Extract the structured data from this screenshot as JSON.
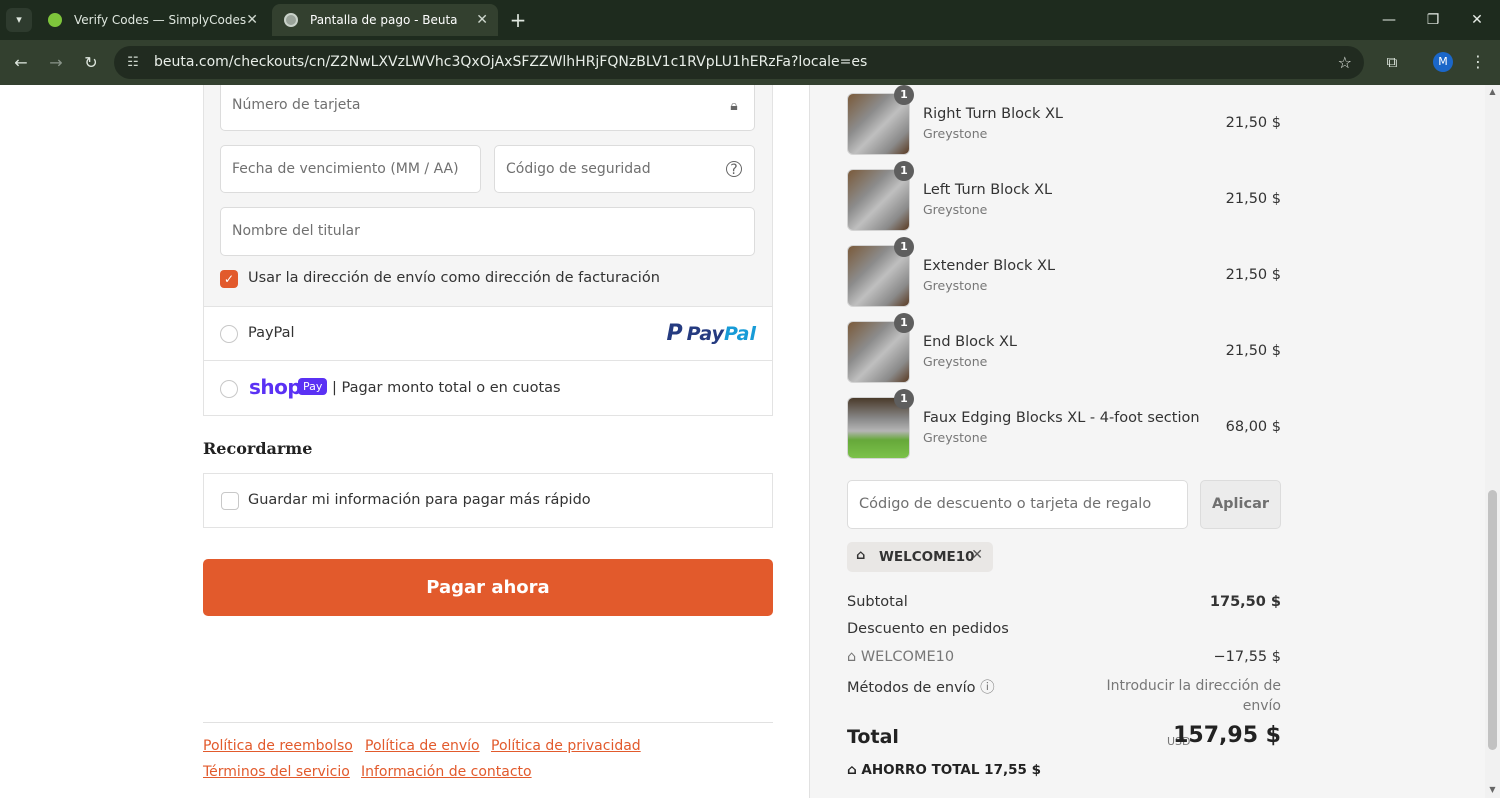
{
  "browser": {
    "tabs": [
      {
        "title": "Verify Codes — SimplyCodes",
        "active": false
      },
      {
        "title": "Pantalla de pago - Beuta",
        "active": true
      }
    ],
    "url": "beuta.com/checkouts/cn/Z2NwLXVzLWVhc3QxOjAxSFZZWlhHRjFQNzBLV1c1RVpLU1hERzFa?locale=es",
    "profile_initial": "M"
  },
  "payment": {
    "card_number_placeholder": "Número de tarjeta",
    "expiry_placeholder": "Fecha de vencimiento (MM / AA)",
    "security_placeholder": "Código de seguridad",
    "holder_placeholder": "Nombre del titular",
    "billing_same_label": "Usar la dirección de envío como dirección de facturación",
    "paypal_label": "PayPal",
    "paypal_logo_pay": "Pay",
    "paypal_logo_pal": "Pal",
    "shop_word": "shop",
    "shop_badge": "Pay",
    "shop_label": "| Pagar monto total o en cuotas"
  },
  "remember": {
    "title": "Recordarme",
    "save_label": "Guardar mi información para pagar más rápido"
  },
  "pay_button": "Pagar ahora",
  "footer_links": [
    "Política de reembolso",
    "Política de envío",
    "Política de privacidad",
    "Términos del servicio",
    "Información de contacto"
  ],
  "order": {
    "items": [
      {
        "name": "Right Turn Block XL",
        "variant": "Greystone",
        "price": "21,50 $",
        "qty": "1"
      },
      {
        "name": "Left Turn Block XL",
        "variant": "Greystone",
        "price": "21,50 $",
        "qty": "1"
      },
      {
        "name": "Extender Block XL",
        "variant": "Greystone",
        "price": "21,50 $",
        "qty": "1"
      },
      {
        "name": "End Block XL",
        "variant": "Greystone",
        "price": "21,50 $",
        "qty": "1"
      },
      {
        "name": "Faux Edging Blocks XL - 4-foot section",
        "variant": "Greystone",
        "price": "68,00 $",
        "qty": "1"
      }
    ],
    "discount_placeholder": "Código de descuento o tarjeta de regalo",
    "apply_label": "Aplicar",
    "applied_code": "WELCOME10",
    "subtotal_label": "Subtotal",
    "subtotal_value": "175,50 $",
    "order_discount_label": "Descuento en pedidos",
    "discount_code": "WELCOME10",
    "discount_value": "−17,55 $",
    "shipping_label": "Métodos de envío",
    "shipping_value": "Introducir la dirección de envío",
    "total_label": "Total",
    "total_currency": "USD",
    "total_value": "157,95 $",
    "savings_label": "AHORRO TOTAL",
    "savings_value": "17,55 $"
  }
}
